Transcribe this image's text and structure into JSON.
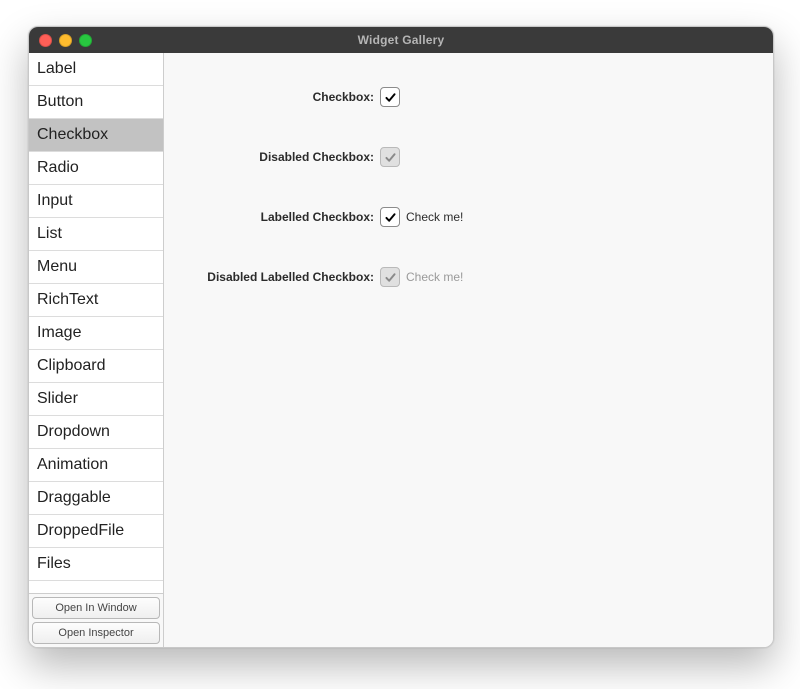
{
  "window": {
    "title": "Widget Gallery"
  },
  "sidebar": {
    "items": [
      {
        "label": "Label",
        "selected": false
      },
      {
        "label": "Button",
        "selected": false
      },
      {
        "label": "Checkbox",
        "selected": true
      },
      {
        "label": "Radio",
        "selected": false
      },
      {
        "label": "Input",
        "selected": false
      },
      {
        "label": "List",
        "selected": false
      },
      {
        "label": "Menu",
        "selected": false
      },
      {
        "label": "RichText",
        "selected": false
      },
      {
        "label": "Image",
        "selected": false
      },
      {
        "label": "Clipboard",
        "selected": false
      },
      {
        "label": "Slider",
        "selected": false
      },
      {
        "label": "Dropdown",
        "selected": false
      },
      {
        "label": "Animation",
        "selected": false
      },
      {
        "label": "Draggable",
        "selected": false
      },
      {
        "label": "DroppedFile",
        "selected": false
      },
      {
        "label": "Files",
        "selected": false
      }
    ],
    "open_in_window_label": "Open In Window",
    "open_inspector_label": "Open Inspector"
  },
  "main": {
    "rows": [
      {
        "label": "Checkbox:",
        "checked": true,
        "disabled": false,
        "text": ""
      },
      {
        "label": "Disabled Checkbox:",
        "checked": true,
        "disabled": true,
        "text": ""
      },
      {
        "label": "Labelled Checkbox:",
        "checked": true,
        "disabled": false,
        "text": "Check me!"
      },
      {
        "label": "Disabled Labelled Checkbox:",
        "checked": true,
        "disabled": true,
        "text": "Check me!"
      }
    ]
  }
}
